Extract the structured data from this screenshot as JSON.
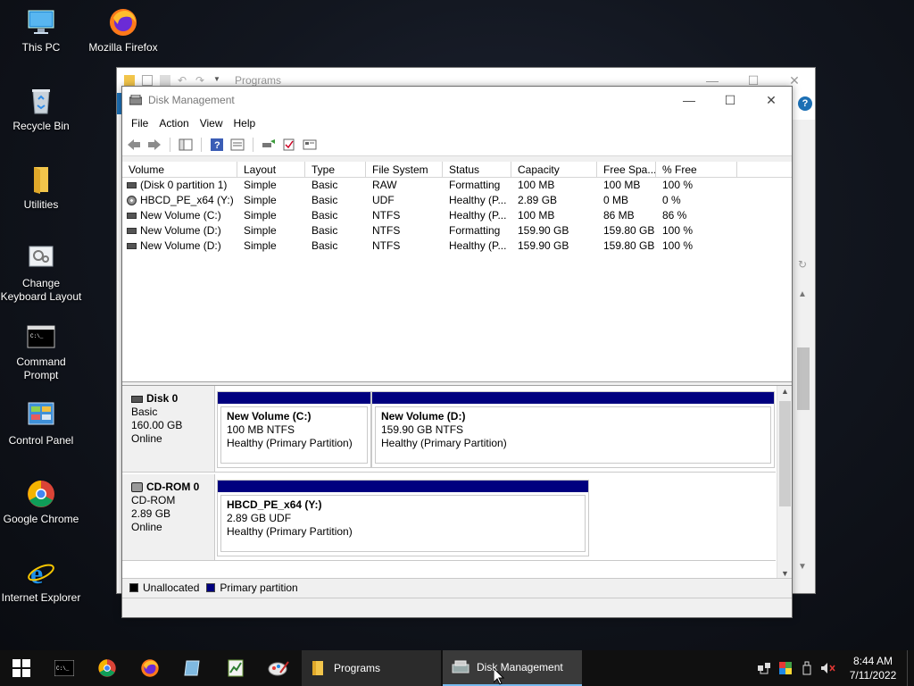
{
  "desktop": {
    "icons": [
      {
        "label": "This PC",
        "icon": "computer-icon"
      },
      {
        "label": "Mozilla Firefox",
        "icon": "firefox-icon"
      },
      {
        "label": "Recycle Bin",
        "icon": "recycle-bin-icon"
      },
      {
        "label": "Utilities",
        "icon": "folder-icon"
      },
      {
        "label": "Change Keyboard Layout",
        "icon": "keyboard-layout-icon"
      },
      {
        "label": "Command Prompt",
        "icon": "command-prompt-icon"
      },
      {
        "label": "Control Panel",
        "icon": "control-panel-icon"
      },
      {
        "label": "Google Chrome",
        "icon": "chrome-icon"
      },
      {
        "label": "Internet Explorer",
        "icon": "internet-explorer-icon"
      }
    ]
  },
  "explorer": {
    "title": "Programs"
  },
  "disk_management": {
    "title": "Disk Management",
    "menu": [
      "File",
      "Action",
      "View",
      "Help"
    ],
    "columns": [
      "Volume",
      "Layout",
      "Type",
      "File System",
      "Status",
      "Capacity",
      "Free Spa...",
      "% Free"
    ],
    "volumes": [
      {
        "volume": "(Disk 0 partition 1)",
        "layout": "Simple",
        "type": "Basic",
        "fs": "RAW",
        "status": "Formatting",
        "capacity": "100 MB",
        "free": "100 MB",
        "pct": "100 %",
        "icon": "disk"
      },
      {
        "volume": "HBCD_PE_x64 (Y:)",
        "layout": "Simple",
        "type": "Basic",
        "fs": "UDF",
        "status": "Healthy (P...",
        "capacity": "2.89 GB",
        "free": "0 MB",
        "pct": "0 %",
        "icon": "cd"
      },
      {
        "volume": "New Volume (C:)",
        "layout": "Simple",
        "type": "Basic",
        "fs": "NTFS",
        "status": "Healthy (P...",
        "capacity": "100 MB",
        "free": "86 MB",
        "pct": "86 %",
        "icon": "disk"
      },
      {
        "volume": "New Volume (D:)",
        "layout": "Simple",
        "type": "Basic",
        "fs": "NTFS",
        "status": "Formatting",
        "capacity": "159.90 GB",
        "free": "159.80 GB",
        "pct": "100 %",
        "icon": "disk"
      },
      {
        "volume": "New Volume (D:)",
        "layout": "Simple",
        "type": "Basic",
        "fs": "NTFS",
        "status": "Healthy (P...",
        "capacity": "159.90 GB",
        "free": "159.80 GB",
        "pct": "100 %",
        "icon": "disk"
      }
    ],
    "disks": [
      {
        "name": "Disk 0",
        "type": "Basic",
        "size": "160.00 GB",
        "state": "Online",
        "partitions": [
          {
            "name": "New Volume  (C:)",
            "size": "100 MB NTFS",
            "status": "Healthy (Primary Partition)"
          },
          {
            "name": "New Volume  (D:)",
            "size": "159.90 GB NTFS",
            "status": "Healthy (Primary Partition)"
          }
        ]
      },
      {
        "name": "CD-ROM 0",
        "type": "CD-ROM",
        "size": "2.89 GB",
        "state": "Online",
        "partitions": [
          {
            "name": "HBCD_PE_x64  (Y:)",
            "size": "2.89 GB UDF",
            "status": "Healthy (Primary Partition)"
          }
        ]
      }
    ],
    "legend": [
      {
        "label": "Unallocated",
        "color": "#000000"
      },
      {
        "label": "Primary partition",
        "color": "#00007f"
      }
    ]
  },
  "taskbar": {
    "windows": [
      {
        "label": "Programs"
      },
      {
        "label": "Disk Management"
      }
    ],
    "clock": {
      "time": "8:44 AM",
      "date": "7/11/2022"
    }
  },
  "colors": {
    "primary_partition": "#00007f",
    "taskbar": "#101010",
    "active_window_tab": "#3a3a3a"
  }
}
